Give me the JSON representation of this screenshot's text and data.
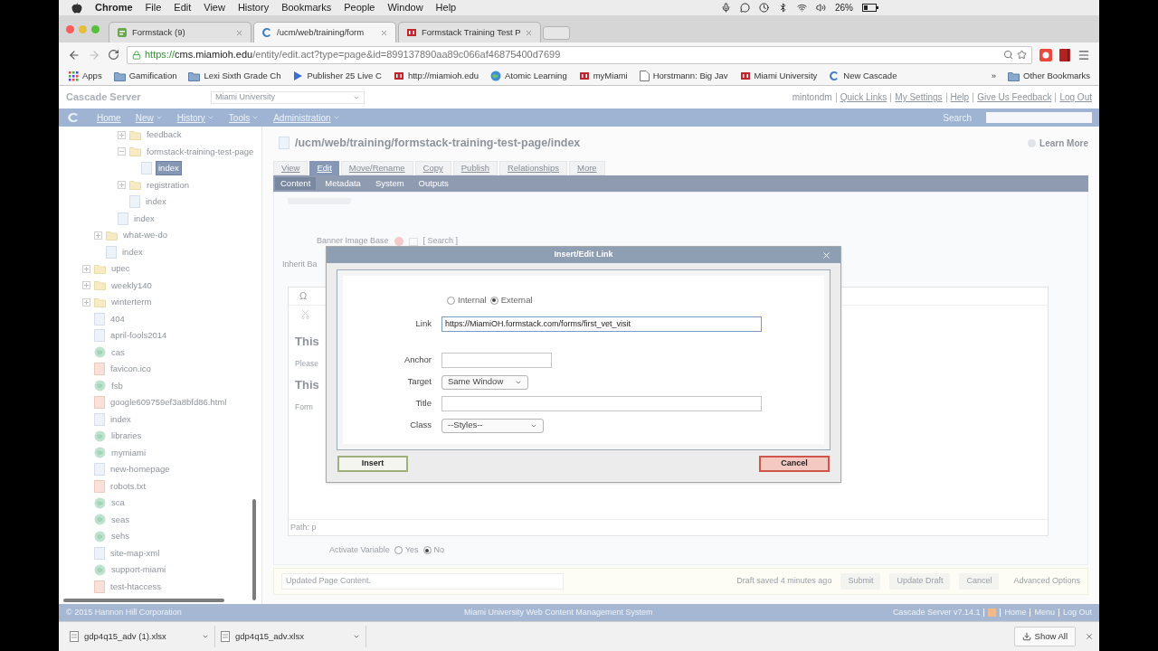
{
  "menu_bar": {
    "app": "Chrome",
    "items": [
      "File",
      "Edit",
      "View",
      "History",
      "Bookmarks",
      "People",
      "Window",
      "Help"
    ],
    "battery": "26%"
  },
  "browser_tabs": [
    {
      "kind": "form",
      "title": "Formstack (9)",
      "selected": false
    },
    {
      "kind": "swirl",
      "title": "/ucm/web/training/form",
      "selected": true
    },
    {
      "kind": "m_logo",
      "title": "Formstack Training Test P",
      "selected": false
    }
  ],
  "address": {
    "scheme": "https://",
    "host": "cms.miamioh.edu",
    "path": "/entity/edit.act?type=page&id=899137890aa89c066af46875400d7699"
  },
  "bookmarks": [
    {
      "kind": "apps",
      "label": "Apps"
    },
    {
      "kind": "folder",
      "label": "Gamification"
    },
    {
      "kind": "folder",
      "label": "Lexi Sixth Grade Ch"
    },
    {
      "kind": "arrow",
      "label": "Publisher 25 Live C"
    },
    {
      "kind": "m_logo",
      "label": "http://miamioh.edu"
    },
    {
      "kind": "globe",
      "label": "Atomic Learning"
    },
    {
      "kind": "m_logo",
      "label": "myMiami"
    },
    {
      "kind": "page",
      "label": "Horstmann: Big Jav"
    },
    {
      "kind": "m_logo",
      "label": "Miami University"
    },
    {
      "kind": "swirl",
      "label": "New Cascade"
    }
  ],
  "bookmarks_more": "»",
  "other_bookmarks": "Other Bookmarks",
  "cms_header": {
    "brand": "Cascade Server",
    "site": "Miami University",
    "user": "mintondm",
    "links": [
      "Quick Links",
      "My Settings",
      "Help",
      "Give Us Feedback",
      "Log Out"
    ]
  },
  "nav": {
    "items": [
      {
        "label": "Home",
        "menu": false
      },
      {
        "label": "New",
        "menu": true
      },
      {
        "label": "History",
        "menu": true
      },
      {
        "label": "Tools",
        "menu": true
      },
      {
        "label": "Administration",
        "menu": true
      }
    ],
    "search_label": "Search"
  },
  "tree": [
    {
      "kind": "continued",
      "children": [
        {
          "kind": "continued",
          "children": [
            {
              "kind": "continued",
              "children": [
                {
                  "kind": "folder",
                  "label": "feedback",
                  "expanded": false,
                  "selected": false
                },
                {
                  "kind": "folder",
                  "label": "formstack-training-test-page",
                  "expanded": true,
                  "selected": false,
                  "children": [
                    {
                      "kind": "page",
                      "label": "index",
                      "selected": true
                    }
                  ]
                },
                {
                  "kind": "folder",
                  "label": "registration",
                  "expanded": false,
                  "selected": false
                },
                {
                  "kind": "page",
                  "label": "index",
                  "selected": false
                }
              ]
            },
            {
              "kind": "page",
              "label": "index",
              "selected": false
            }
          ]
        },
        {
          "kind": "folder",
          "label": "what-we-do",
          "expanded": false,
          "selected": false
        },
        {
          "kind": "page",
          "label": "index",
          "selected": false
        }
      ]
    },
    {
      "kind": "folder",
      "label": "upec",
      "expanded": false,
      "selected": false
    },
    {
      "kind": "folder",
      "label": "weekly140",
      "expanded": false,
      "selected": false
    },
    {
      "kind": "folder",
      "label": "winterterm",
      "expanded": false,
      "selected": false
    },
    {
      "kind": "page",
      "label": "404",
      "selected": false
    },
    {
      "kind": "page",
      "label": "april-fools2014",
      "selected": false
    },
    {
      "kind": "reference",
      "label": "cas",
      "selected": false
    },
    {
      "kind": "file",
      "label": "favicon.ico",
      "selected": false
    },
    {
      "kind": "reference",
      "label": "fsb",
      "selected": false
    },
    {
      "kind": "file",
      "label": "google609759ef3a8bfd86.html",
      "selected": false
    },
    {
      "kind": "page",
      "label": "index",
      "selected": false
    },
    {
      "kind": "reference",
      "label": "libraries",
      "selected": false
    },
    {
      "kind": "reference",
      "label": "mymiami",
      "selected": false
    },
    {
      "kind": "page",
      "label": "new-homepage",
      "selected": false
    },
    {
      "kind": "file",
      "label": "robots.txt",
      "selected": false
    },
    {
      "kind": "reference",
      "label": "sca",
      "selected": false
    },
    {
      "kind": "reference",
      "label": "seas",
      "selected": false
    },
    {
      "kind": "reference",
      "label": "sehs",
      "selected": false
    },
    {
      "kind": "page",
      "label": "site-map-xml",
      "selected": false
    },
    {
      "kind": "reference",
      "label": "support-miami",
      "selected": false
    },
    {
      "kind": "file",
      "label": "test-htaccess",
      "selected": false
    }
  ],
  "page": {
    "path": "/ucm/web/training/formstack-training-test-page/index",
    "learn_more": "Learn More",
    "tabs": [
      {
        "label": "View",
        "selected": false
      },
      {
        "label": "Edit",
        "selected": true
      },
      {
        "label": "Move/Rename",
        "selected": false
      },
      {
        "label": "Copy",
        "selected": false
      },
      {
        "label": "Publish",
        "selected": false
      },
      {
        "label": "Relationships",
        "selected": false
      },
      {
        "label": "More",
        "selected": false
      }
    ],
    "subtabs": [
      {
        "label": "Content",
        "selected": true
      },
      {
        "label": "Metadata",
        "selected": false
      },
      {
        "label": "System",
        "selected": false
      },
      {
        "label": "Outputs",
        "selected": false
      }
    ]
  },
  "form": {
    "special_char": "Ω",
    "banner_label": "Banner Image Base",
    "banner_search": "[ Search ]",
    "inherit_label": "Inherit Ba",
    "editor_lines": [
      {
        "kind": "heading",
        "text": "This"
      },
      {
        "kind": "para",
        "text": "Please"
      },
      {
        "kind": "heading",
        "text": "This"
      },
      {
        "kind": "para",
        "text": "Form"
      }
    ],
    "path": "Path: p",
    "activate_label": "Activate Variable",
    "activate_options": [
      {
        "label": "Yes",
        "selected": false
      },
      {
        "label": "No",
        "selected": true
      }
    ]
  },
  "action_bar": {
    "comment": "Updated Page Content.",
    "draft_status": "Draft saved 4 minutes ago",
    "buttons": [
      "Submit",
      "Update Draft",
      "Cancel"
    ],
    "advanced": "Advanced Options"
  },
  "dialog": {
    "title": "Insert/Edit Link",
    "link_type": [
      {
        "label": "Internal",
        "selected": false
      },
      {
        "label": "External",
        "selected": true
      }
    ],
    "fields": [
      {
        "kind": "long_text",
        "label": "Link",
        "value": "https://MiamiOH.formstack.com/forms/first_vet_visit"
      },
      {
        "kind": "short_text",
        "label": "Anchor"
      },
      {
        "kind": "select",
        "label": "Target",
        "value": "Same Window"
      },
      {
        "kind": "long_text",
        "label": "Title"
      },
      {
        "kind": "select",
        "label": "Class",
        "value": "--Styles--"
      }
    ],
    "insert": "Insert",
    "cancel": "Cancel"
  },
  "footer": {
    "copyright": "© 2015 Hannon Hill Corporation",
    "title": "Miami University Web Content Management System",
    "version": "Cascade Server v7.14.1",
    "links": [
      "Home",
      "Menu",
      "Log Out"
    ]
  },
  "downloads": [
    {
      "name": "gdp4q15_adv (1).xlsx"
    },
    {
      "name": "gdp4q15_adv.xlsx"
    }
  ],
  "show_all": "Show All"
}
